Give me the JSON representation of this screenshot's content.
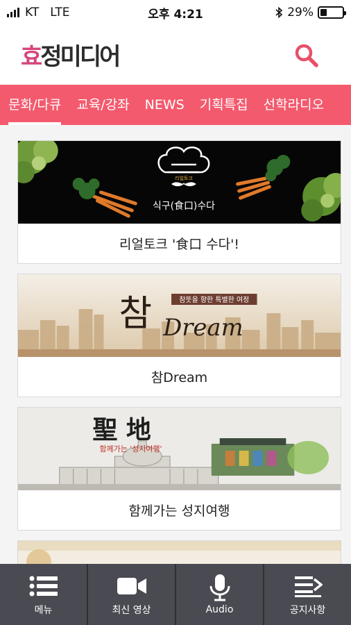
{
  "status_bar": {
    "carrier": "KT",
    "network": "LTE",
    "time": "오후 4:21",
    "battery_percent": "29%",
    "battery_level": 0.29
  },
  "header": {
    "logo_text": "효정미디어",
    "logo_accent_color": "#d5457a",
    "search_icon": "search-icon"
  },
  "nav": {
    "background_color": "#f45a6e",
    "tabs": [
      {
        "label": "문화/다큐",
        "active": true
      },
      {
        "label": "교육/강좌",
        "active": false
      },
      {
        "label": "NEWS",
        "active": false
      },
      {
        "label": "기획특집",
        "active": false
      },
      {
        "label": "선학라디오",
        "active": false
      }
    ]
  },
  "cards": [
    {
      "title": "리얼토크 '食口 수다'!",
      "banner_small_text": "리얼토크",
      "banner_text": "식구(食口)수다"
    },
    {
      "title": "참Dream",
      "banner_big_char": "참",
      "banner_tagline": "참뜻을 향한 특별한 여정",
      "banner_script": "Dream"
    },
    {
      "title": "함께가는 성지여행",
      "banner_chars": "聖 地",
      "banner_subtitle": "함께가는 '성지여행'"
    }
  ],
  "bottom_nav": [
    {
      "label": "메뉴",
      "icon": "menu-list-icon"
    },
    {
      "label": "최신 영상",
      "icon": "video-camera-icon"
    },
    {
      "label": "Audio",
      "icon": "microphone-icon"
    },
    {
      "label": "공지사항",
      "icon": "notice-list-icon"
    }
  ]
}
